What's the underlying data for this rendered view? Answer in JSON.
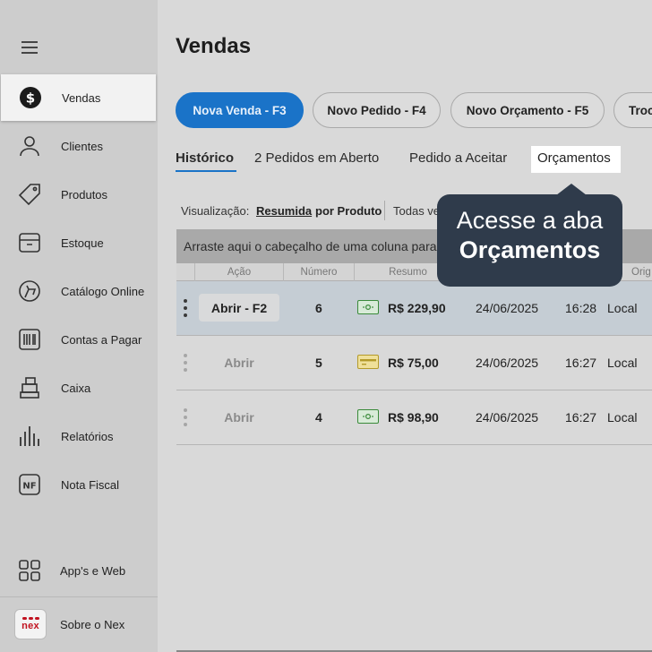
{
  "sidebar": {
    "items": [
      {
        "label": "Vendas",
        "icon": "dollar-circle-icon",
        "active": true
      },
      {
        "label": "Clientes",
        "icon": "person-icon"
      },
      {
        "label": "Produtos",
        "icon": "tag-icon"
      },
      {
        "label": "Estoque",
        "icon": "box-icon"
      },
      {
        "label": "Catálogo Online",
        "icon": "catalog-icon"
      },
      {
        "label": "Contas a Pagar",
        "icon": "barcode-icon"
      },
      {
        "label": "Caixa",
        "icon": "cash-register-icon"
      },
      {
        "label": "Relatórios",
        "icon": "bar-chart-icon"
      },
      {
        "label": "Nota Fiscal",
        "icon": "nf-icon"
      }
    ],
    "footer": [
      {
        "label": "App's e Web",
        "icon": "grid-icon"
      },
      {
        "label": "Sobre o Nex",
        "icon": "nex-logo"
      }
    ],
    "logo_text": "nex"
  },
  "page": {
    "title": "Vendas"
  },
  "actions": {
    "new_sale": "Nova Venda - F3",
    "new_order": "Novo Pedido - F4",
    "new_quote": "Novo Orçamento - F5",
    "exchange": "Troca"
  },
  "tabs": {
    "history": "Histórico",
    "open_orders": "2 Pedidos em Aberto",
    "to_accept": "Pedido a Aceitar",
    "quotes": "Orçamentos"
  },
  "view": {
    "label": "Visualização:",
    "summary": "Resumida",
    "by_product": "por Produto",
    "all": "Todas ve"
  },
  "grid": {
    "group_hint": "Arraste aqui o cabeçalho de uma coluna para",
    "headers": [
      "Ação",
      "Número",
      "Resumo",
      "Orig"
    ],
    "rows": [
      {
        "action": "Abrir - F2",
        "number": "6",
        "payment": "cash",
        "amount": "R$ 229,90",
        "date": "24/06/2025",
        "time": "16:28",
        "origin": "Local"
      },
      {
        "action": "Abrir",
        "number": "5",
        "payment": "card",
        "amount": "R$ 75,00",
        "date": "24/06/2025",
        "time": "16:27",
        "origin": "Local"
      },
      {
        "action": "Abrir",
        "number": "4",
        "payment": "cash",
        "amount": "R$ 98,90",
        "date": "24/06/2025",
        "time": "16:27",
        "origin": "Local"
      }
    ]
  },
  "tooltip": {
    "line1": "Acesse a aba",
    "line2": "Orçamentos"
  },
  "colors": {
    "primary": "#1a73c8",
    "tooltip_bg": "#2f3b4b",
    "cash_green": "#3a8a3a",
    "card_yellow": "#e3c95a"
  }
}
